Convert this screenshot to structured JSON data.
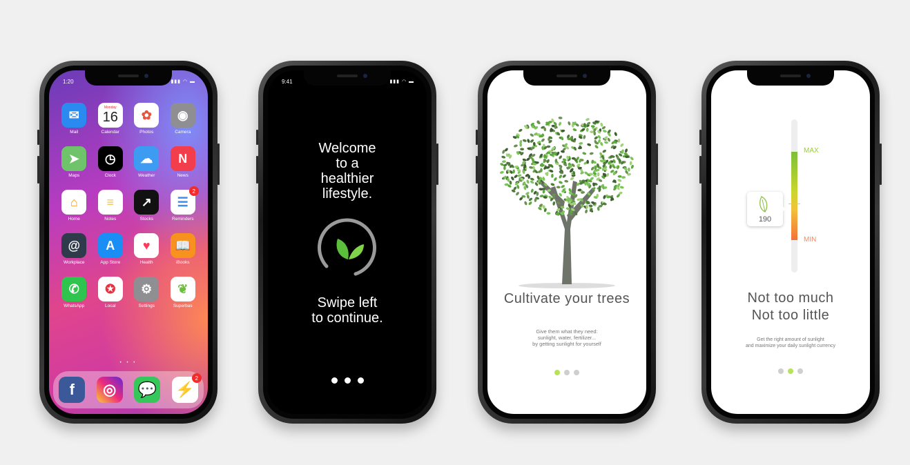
{
  "phone1": {
    "status_time": "1:20",
    "status_icons": "▮▮▮ ◠ ▬",
    "apps": [
      {
        "label": "Mail",
        "icon": "mail-icon",
        "color": "#2a8af0"
      },
      {
        "label": "Calendar",
        "icon": "calendar-icon",
        "color": "#ffffff",
        "day": "Monday",
        "date": "16"
      },
      {
        "label": "Photos",
        "icon": "photos-icon",
        "color": "#ffffff"
      },
      {
        "label": "Camera",
        "icon": "camera-icon",
        "color": "#8e8e93"
      },
      {
        "label": "Maps",
        "icon": "maps-icon",
        "color": "#6fc36b"
      },
      {
        "label": "Clock",
        "icon": "clock-icon",
        "color": "#000000"
      },
      {
        "label": "Weather",
        "icon": "weather-icon",
        "color": "#3d9bf2"
      },
      {
        "label": "News",
        "icon": "news-icon",
        "color": "#f23d4c"
      },
      {
        "label": "Home",
        "icon": "home-icon",
        "color": "#ffffff"
      },
      {
        "label": "Notes",
        "icon": "notes-icon",
        "color": "#ffffff"
      },
      {
        "label": "Stocks",
        "icon": "stocks-icon",
        "color": "#111111"
      },
      {
        "label": "Reminders",
        "icon": "reminders-icon",
        "color": "#ffffff",
        "badge": "2"
      },
      {
        "label": "Workplace",
        "icon": "workplace-icon",
        "color": "#2f3a4a"
      },
      {
        "label": "App Store",
        "icon": "app-store-icon",
        "color": "#1a8ef5"
      },
      {
        "label": "Health",
        "icon": "health-icon",
        "color": "#ffffff"
      },
      {
        "label": "iBooks",
        "icon": "ibooks-icon",
        "color": "#f7921e"
      },
      {
        "label": "WhatsApp",
        "icon": "whatsapp-icon",
        "color": "#2fc44e"
      },
      {
        "label": "Local",
        "icon": "local-icon",
        "color": "#ffffff"
      },
      {
        "label": "Settings",
        "icon": "settings-icon",
        "color": "#8e8e93"
      },
      {
        "label": "Superbas",
        "icon": "superbas-leaf-icon",
        "color": "#ffffff"
      }
    ],
    "page_dots": "• • •",
    "dock": [
      {
        "icon": "facebook-icon",
        "color": "#3b5998",
        "glyph": "f"
      },
      {
        "icon": "instagram-icon",
        "color": "#c13584",
        "glyph": "◎"
      },
      {
        "icon": "messages-icon",
        "color": "#35c759",
        "glyph": "💬"
      },
      {
        "icon": "messenger-icon",
        "color": "#ffffff",
        "glyph": "⚡",
        "badge": "2"
      }
    ]
  },
  "phone2": {
    "status_time": "9:41",
    "status_icons": "▮▮▮ ◠ ▬",
    "welcome": [
      "Welcome",
      "to a",
      "healthier",
      "lifestyle."
    ],
    "swipe": [
      "Swipe left",
      "to continue."
    ]
  },
  "phone3": {
    "title": "Cultivate your trees",
    "body": [
      "Give them what they need:",
      "sunlight, water, fertilizer...",
      "by getting sunlight for yourself"
    ],
    "active_dot": 0
  },
  "phone4": {
    "max_label": "MAX",
    "min_label": "MIN",
    "value": "190",
    "title": [
      "Not too much",
      "Not too little"
    ],
    "body": [
      "Get the right amount of sunlight",
      "and maximize your daily sunlight currency"
    ],
    "active_dot": 1
  }
}
